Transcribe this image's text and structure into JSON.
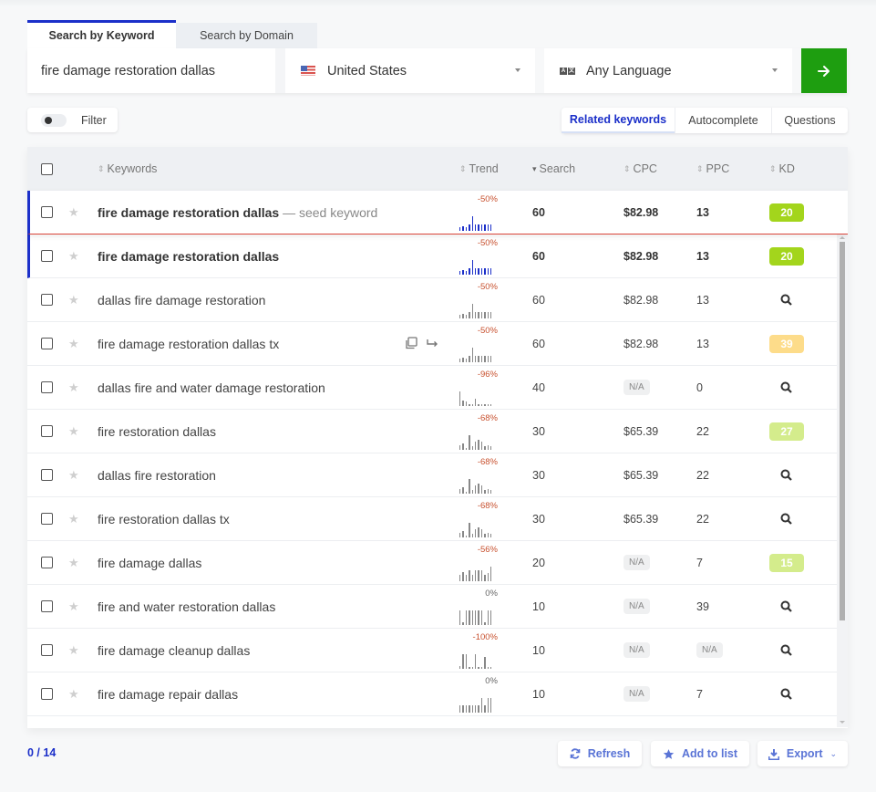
{
  "search_tabs": [
    {
      "label": "Search by Keyword",
      "active": true
    },
    {
      "label": "Search by Domain",
      "active": false
    }
  ],
  "search": {
    "keyword_value": "fire damage restoration dallas",
    "country": "United States",
    "country_icon": "us-flag-icon",
    "language": "Any Language",
    "language_icon": "language-icon",
    "go_icon": "arrow-right-icon"
  },
  "filter": {
    "label": "Filter",
    "enabled": false
  },
  "mode_tabs": [
    {
      "label": "Related keywords",
      "active": true
    },
    {
      "label": "Autocomplete",
      "active": false
    },
    {
      "label": "Questions",
      "active": false
    }
  ],
  "table": {
    "headers": {
      "keywords": "Keywords",
      "trend": "Trend",
      "search": "Search",
      "cpc": "CPC",
      "ppc": "PPC",
      "kd": "KD"
    },
    "sorted_by": "Search",
    "seed_suffix": "— seed keyword",
    "rows": [
      {
        "keyword": "fire damage restoration dallas",
        "seed": true,
        "trend_pct": "-50%",
        "trend": [
          2,
          3,
          2,
          4,
          9,
          4,
          4,
          4,
          4,
          4,
          4
        ],
        "search": "60",
        "cpc": "$82.98",
        "ppc": "13",
        "kd": "20",
        "kd_color": "#a3d51c"
      },
      {
        "keyword": "fire damage restoration dallas",
        "highlighted": true,
        "trend_pct": "-50%",
        "trend": [
          2,
          3,
          2,
          4,
          9,
          4,
          4,
          4,
          4,
          4,
          4
        ],
        "search": "60",
        "cpc": "$82.98",
        "ppc": "13",
        "kd": "20",
        "kd_color": "#a3d51c"
      },
      {
        "keyword": "dallas fire damage restoration",
        "trend_pct": "-50%",
        "trend": [
          2,
          3,
          2,
          4,
          9,
          4,
          4,
          4,
          4,
          4,
          4
        ],
        "search": "60",
        "cpc": "$82.98",
        "ppc": "13",
        "kd": null
      },
      {
        "keyword": "fire damage restoration dallas tx",
        "hover_actions": true,
        "trend_pct": "-50%",
        "trend": [
          2,
          3,
          2,
          4,
          9,
          4,
          4,
          4,
          4,
          4,
          4
        ],
        "search": "60",
        "cpc": "$82.98",
        "ppc": "13",
        "kd": "39",
        "kd_color": "#fddc8a"
      },
      {
        "keyword": "dallas fire and water damage restoration",
        "trend_pct": "-96%",
        "trend": [
          10,
          4,
          3,
          1,
          1,
          5,
          1,
          1,
          1,
          1,
          1
        ],
        "search": "40",
        "cpc": "N/A",
        "ppc": "0",
        "kd": null
      },
      {
        "keyword": "fire restoration dallas",
        "trend_pct": "-68%",
        "trend": [
          3,
          4,
          1,
          9,
          2,
          5,
          6,
          5,
          2,
          3,
          2
        ],
        "search": "30",
        "cpc": "$65.39",
        "ppc": "22",
        "kd": "27",
        "kd_color": "#d4ec8c"
      },
      {
        "keyword": "dallas fire restoration",
        "trend_pct": "-68%",
        "trend": [
          3,
          4,
          1,
          9,
          2,
          5,
          6,
          5,
          2,
          3,
          2
        ],
        "search": "30",
        "cpc": "$65.39",
        "ppc": "22",
        "kd": null
      },
      {
        "keyword": "fire restoration dallas tx",
        "trend_pct": "-68%",
        "trend": [
          3,
          4,
          1,
          9,
          2,
          5,
          6,
          5,
          2,
          3,
          2
        ],
        "search": "30",
        "cpc": "$65.39",
        "ppc": "22",
        "kd": null
      },
      {
        "keyword": "fire damage dallas",
        "trend_pct": "-56%",
        "trend": [
          5,
          7,
          5,
          8,
          5,
          8,
          8,
          8,
          5,
          6,
          11
        ],
        "search": "20",
        "cpc": "N/A",
        "ppc": "7",
        "kd": "15",
        "kd_color": "#d4ec8c"
      },
      {
        "keyword": "fire and water restoration dallas",
        "trend_pct": "0%",
        "trend": [
          10,
          2,
          10,
          10,
          10,
          10,
          10,
          10,
          2,
          10,
          10
        ],
        "search": "10",
        "cpc": "N/A",
        "ppc": "39",
        "kd": null
      },
      {
        "keyword": "fire damage cleanup dallas",
        "trend_pct": "-100%",
        "trend": [
          2,
          10,
          10,
          1,
          1,
          10,
          1,
          1,
          8,
          1,
          1
        ],
        "search": "10",
        "cpc": "N/A",
        "ppc": "N/A",
        "kd": null
      },
      {
        "keyword": "fire damage repair dallas",
        "trend_pct": "0%",
        "trend": [
          4,
          4,
          4,
          4,
          4,
          4,
          4,
          8,
          4,
          8,
          8
        ],
        "search": "10",
        "cpc": "N/A",
        "ppc": "7",
        "kd": null
      }
    ]
  },
  "footer": {
    "selection_count": "0 / 14",
    "refresh_label": "Refresh",
    "add_to_list_label": "Add to list",
    "export_label": "Export"
  },
  "colors": {
    "accent": "#1b2fc9",
    "go_button": "#1e9e10",
    "trend_negative": "#c8512f",
    "footer_button_text": "#5a74d6"
  }
}
